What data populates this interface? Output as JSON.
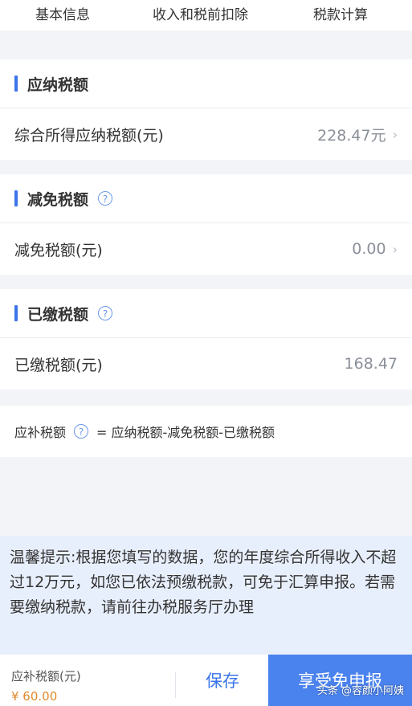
{
  "tabs": [
    "基本信息",
    "收入和税前扣除",
    "税款计算"
  ],
  "sections": {
    "payable": {
      "title": "应纳税额",
      "row_label": "综合所得应纳税额(元)",
      "row_value": "228.47元"
    },
    "reduction": {
      "title": "减免税额",
      "row_label": "减免税额(元)",
      "row_value": "0.00"
    },
    "paid": {
      "title": "已缴税额",
      "row_label": "已缴税额(元)",
      "row_value": "168.47"
    }
  },
  "formula": {
    "label": "应补税额",
    "expression": "= 应纳税额-减免税额-已缴税额"
  },
  "tip": "温馨提示:根据您填写的数据，您的年度综合所得收入不超过12万元，如您已依法预缴税款，可免于汇算申报。若需要缴纳税款，请前往办税服务厅办理",
  "footer": {
    "label": "应补税额(元)",
    "amount": "¥ 60.00",
    "save": "保存",
    "declare": "享受免申报"
  },
  "watermark": "头条 @容颜小阿姨",
  "colors": {
    "accent": "#3a74e8",
    "amount": "#e08a2b",
    "tip_bg": "#e8effc"
  }
}
